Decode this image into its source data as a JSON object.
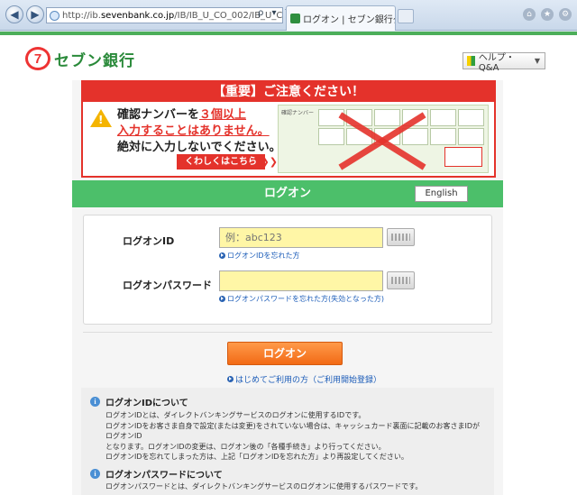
{
  "browser": {
    "url_prefix": "http://ib.",
    "url_host": "sevenbank.co.jp",
    "url_path": "/IB/IB_U_CO_002/IB_U_CO_(",
    "url_tools": "ρ ▾ ↻",
    "tab_title": "ログオン | セブン銀行ダ...",
    "tab_close": "×",
    "icons": [
      "home-icon",
      "star-icon",
      "gear-icon"
    ]
  },
  "header": {
    "logo_mark": "7",
    "logo_text": "セブン銀行",
    "help_label": "ヘルプ・Q&A"
  },
  "banner": {
    "head": "【重要】ご注意ください！",
    "line1_a": "確認ナンバーを",
    "line1_b": "３個以上",
    "line2": "入力することはありません。",
    "line3": "絶対に入力しないでください。",
    "detail_button": "くわしくはこちら",
    "card_label": "確認ナンバー"
  },
  "login": {
    "title": "ログオン",
    "english_button": "English",
    "id_label": "ログオンID",
    "id_placeholder": "例：abc123",
    "id_forgot": "ログオンIDを忘れた方",
    "pw_label": "ログオンパスワード",
    "pw_forgot": "ログオンパスワードを忘れた方(失効となった方)",
    "submit": "ログオン",
    "first_time": "はじめてご利用の方（ご利用開始登録）"
  },
  "info": {
    "sections": [
      {
        "title": "ログオンIDについて",
        "lines": [
          "ログオンIDとは、ダイレクトバンキングサービスのログオンに使用するIDです。",
          "ログオンIDをお客さま自身で設定(または変更)をされていない場合は、キャッシュカード裏面に記載のお客さまIDがログオンID",
          "となります。ログオンIDの変更は、ログオン後の「各種手続き」より行ってください。",
          "ログオンIDを忘れてしまった方は、上記「ログオンIDを忘れた方」より再設定してください。"
        ]
      },
      {
        "title": "ログオンパスワードについて",
        "lines": [
          "ログオンパスワードとは、ダイレクトバンキングサービスのログオンに使用するパスワードです。"
        ]
      }
    ]
  },
  "colors": {
    "brand_green": "#4cbf6a",
    "alert_red": "#e4322b",
    "button_orange": "#f26a15",
    "input_yellow": "#fff6a6"
  }
}
